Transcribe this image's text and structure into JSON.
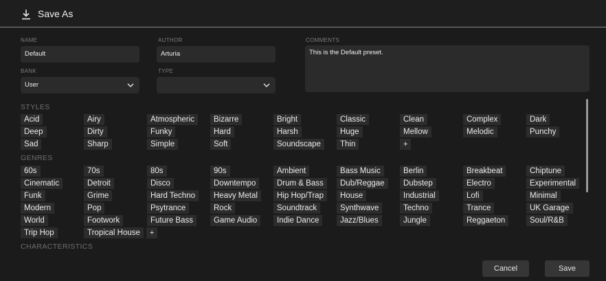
{
  "dialog": {
    "title": "Save As",
    "icon": "download-icon"
  },
  "form": {
    "name_label": "NAME",
    "name_value": "Default",
    "author_label": "AUTHOR",
    "author_value": "Arturia",
    "comments_label": "COMMENTS",
    "comments_value": "This is the Default preset.",
    "bank_label": "BANK",
    "bank_value": "User",
    "type_label": "TYPE",
    "type_value": ""
  },
  "styles": {
    "heading": "STYLES",
    "tags": [
      "Acid",
      "Airy",
      "Atmospheric",
      "Bizarre",
      "Bright",
      "Classic",
      "Clean",
      "Complex",
      "Dark",
      "Deep",
      "Dirty",
      "Funky",
      "Hard",
      "Harsh",
      "Huge",
      "Mellow",
      "Melodic",
      "Punchy",
      "Sad",
      "Sharp",
      "Simple",
      "Soft",
      "Soundscape",
      "Thin"
    ],
    "add_label": "+"
  },
  "genres": {
    "heading": "GENRES",
    "tags": [
      "60s",
      "70s",
      "80s",
      "90s",
      "Ambient",
      "Bass Music",
      "Berlin",
      "Breakbeat",
      "Chiptune",
      "Cinematic",
      "Detroit",
      "Disco",
      "Downtempo",
      "Drum & Bass",
      "Dub/Reggae",
      "Dubstep",
      "Electro",
      "Experimental",
      "Funk",
      "Grime",
      "Hard Techno",
      "Heavy Metal",
      "Hip Hop/Trap",
      "House",
      "Industrial",
      "Lofi",
      "Minimal",
      "Modern",
      "Pop",
      "Psytrance",
      "Rock",
      "Soundtrack",
      "Synthwave",
      "Techno",
      "Trance",
      "UK Garage",
      "World",
      "Footwork",
      "Future Bass",
      "Game Audio",
      "Indie Dance",
      "Jazz/Blues",
      "Jungle",
      "Reggaeton",
      "Soul/R&B",
      "Trip Hop",
      "Tropical House"
    ],
    "add_label": "+"
  },
  "characteristics": {
    "heading": "CHARACTERISTICS"
  },
  "buttons": {
    "cancel": "Cancel",
    "save": "Save"
  },
  "colors": {
    "background": "#1b1b1b",
    "field": "#2b2b2b",
    "chip": "#2c2c2c",
    "divider": "#8a8a8a"
  }
}
